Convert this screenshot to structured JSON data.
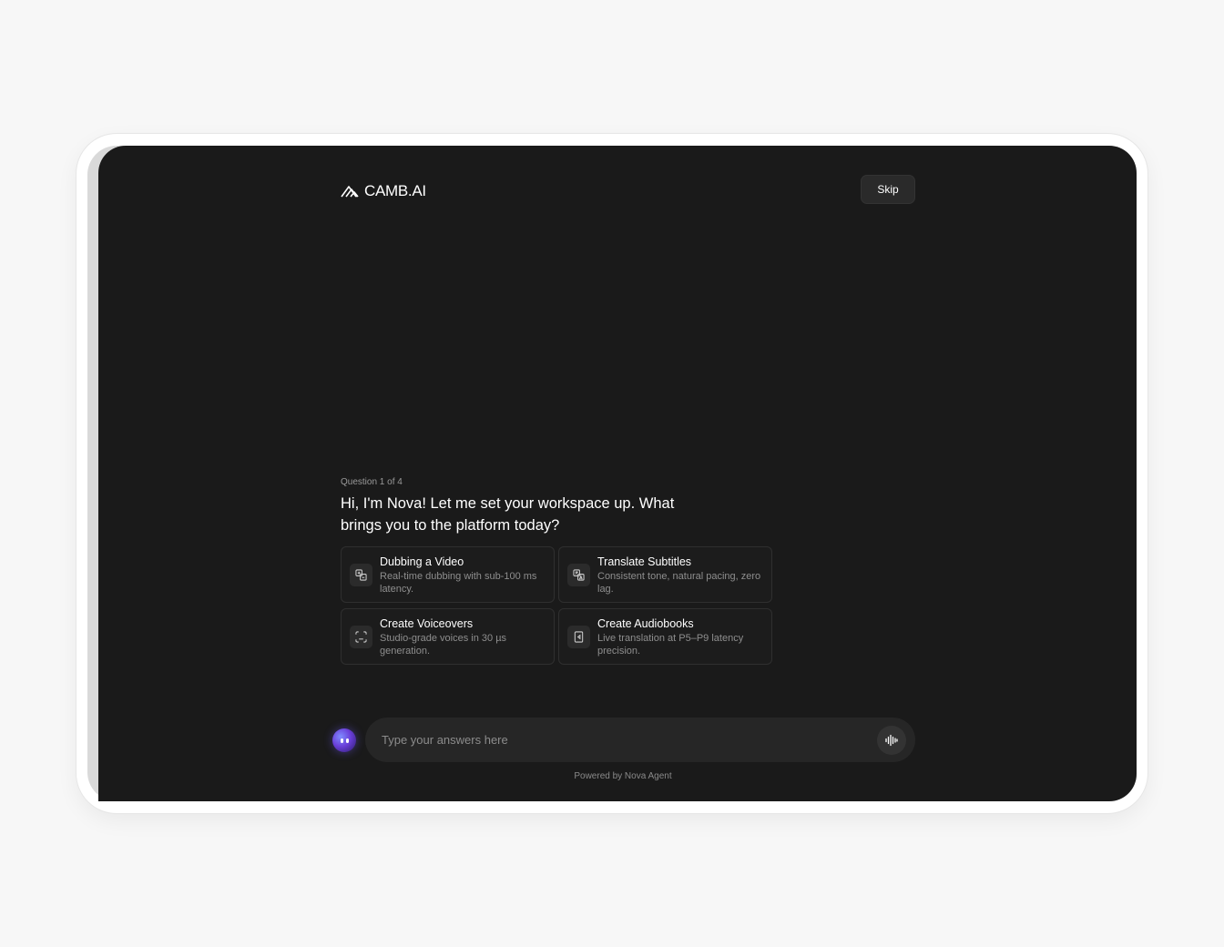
{
  "header": {
    "logo_text": "CAMB.AI",
    "skip_label": "Skip"
  },
  "question": {
    "counter": "Question 1 of 4",
    "title": "Hi, I'm Nova! Let me set your workspace up. What brings you to the platform today?"
  },
  "options": [
    {
      "title": "Dubbing a Video",
      "description": "Real-time dubbing with sub-100 ms latency.",
      "icon": "dubbing-icon"
    },
    {
      "title": "Translate Subtitles",
      "description": "Consistent tone, natural pacing, zero lag.",
      "icon": "translate-icon"
    },
    {
      "title": "Create Voiceovers",
      "description": "Studio-grade voices in 30 µs generation.",
      "icon": "voiceover-icon"
    },
    {
      "title": "Create Audiobooks",
      "description": "Live translation at P5–P9 latency precision.",
      "icon": "audiobook-icon"
    }
  ],
  "chat": {
    "placeholder": "Type your answers here",
    "value": ""
  },
  "footer": {
    "powered_by": "Powered by Nova Agent"
  },
  "colors": {
    "page_bg": "#f7f7f7",
    "screen_bg": "#1a1a1a",
    "card_border": "#2f2f2f",
    "input_bg": "#262626",
    "avatar_accent": "#6a3fd9"
  }
}
